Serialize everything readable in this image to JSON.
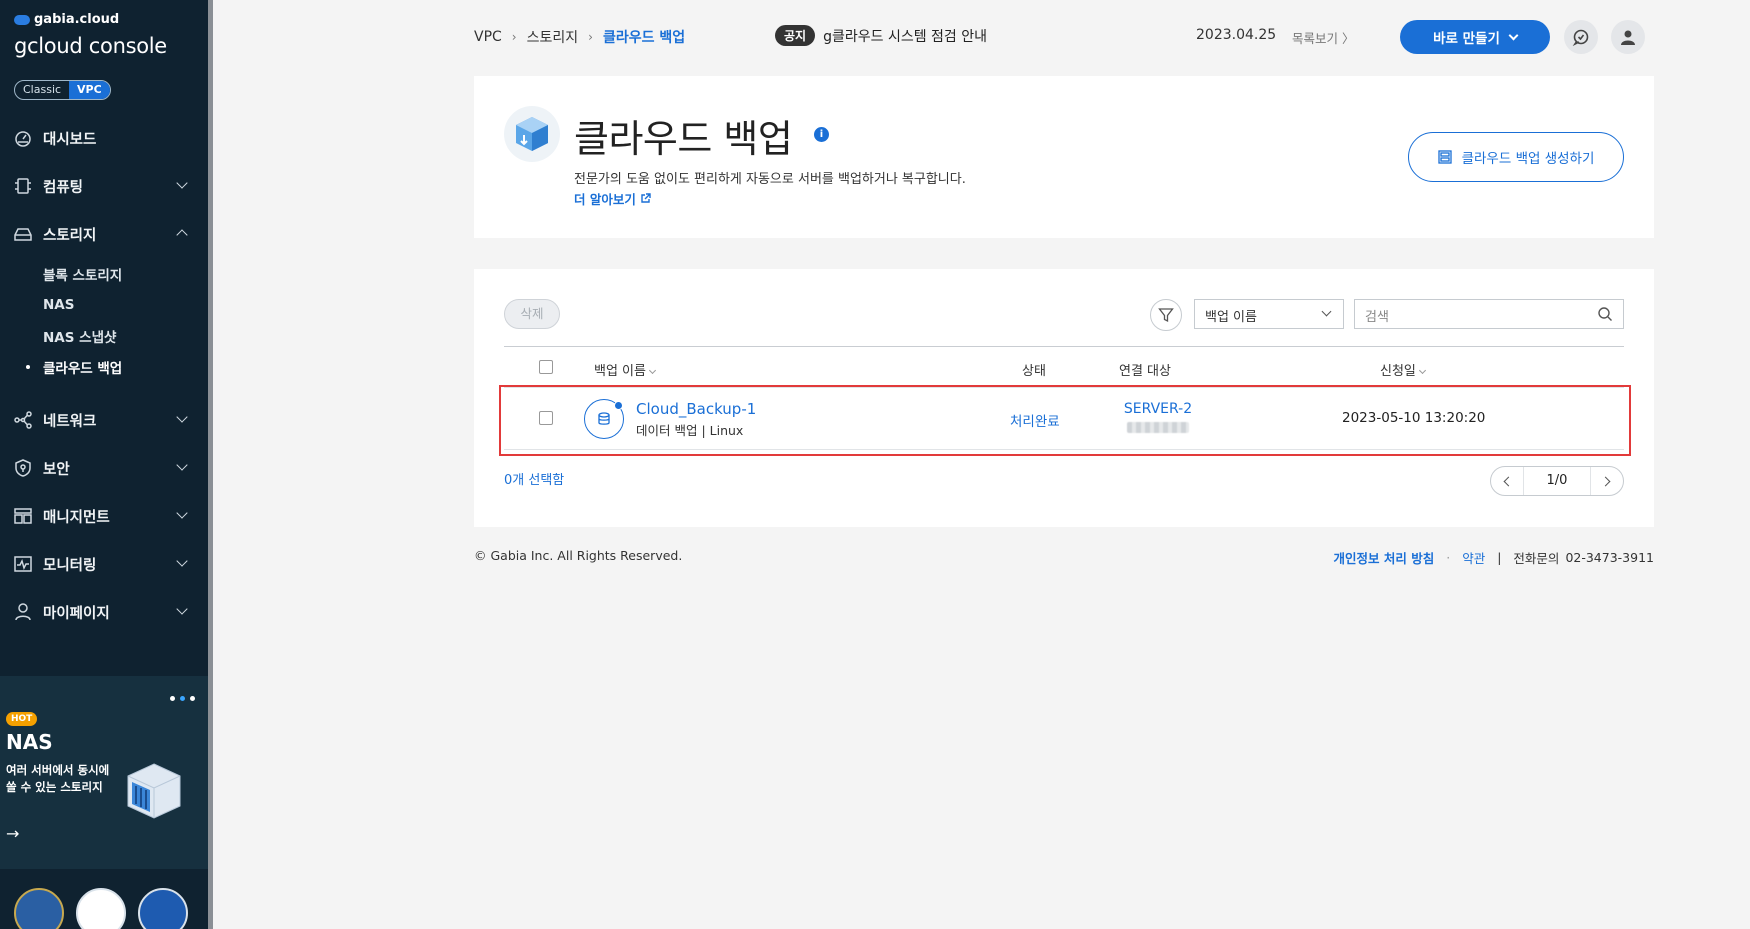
{
  "sidebar": {
    "brand_small": "gabia.cloud",
    "brand_main_bold": "gcloud",
    "brand_main_rest": " console",
    "modes": [
      "Classic",
      "VPC"
    ],
    "active_mode": "VPC",
    "nav": [
      {
        "label": "대시보드",
        "icon": "dashboard-icon"
      },
      {
        "label": "컴퓨팅",
        "icon": "cpu-icon",
        "expanded": false
      },
      {
        "label": "스토리지",
        "icon": "storage-icon",
        "expanded": true
      },
      {
        "label": "네트워크",
        "icon": "network-icon",
        "expanded": false
      },
      {
        "label": "보안",
        "icon": "shield-icon",
        "expanded": false
      },
      {
        "label": "매니지먼트",
        "icon": "management-icon",
        "expanded": false
      },
      {
        "label": "모니터링",
        "icon": "monitoring-icon",
        "expanded": false
      },
      {
        "label": "마이페이지",
        "icon": "user-icon",
        "expanded": false
      }
    ],
    "storage_sub": [
      "블록 스토리지",
      "NAS",
      "NAS 스냅샷",
      "클라우드 백업"
    ],
    "current_sub": "클라우드 백업",
    "promo": {
      "badge": "HOT",
      "title": "NAS",
      "desc_line1": "여러 서버에서 동시에",
      "desc_line2": "쓸 수 있는 스토리지",
      "arrow": "→"
    }
  },
  "topbar": {
    "breadcrumb": [
      "VPC",
      "스토리지",
      "클라우드 백업"
    ],
    "notice_tag": "공지",
    "notice_text": "g클라우드 시스템 점검 안내",
    "notice_date": "2023.04.25",
    "notice_more": "목록보기 〉",
    "create_label": "바로 만들기"
  },
  "header": {
    "title": "클라우드 백업",
    "info": "i",
    "description": "전문가의 도움 없이도 편리하게 자동으로 서버를 백업하거나 복구합니다.",
    "learn_more": "더 알아보기",
    "create_button": "클라우드 백업 생성하기"
  },
  "list": {
    "delete_label": "삭제",
    "filter_select": "백업 이름",
    "search_placeholder": "검색",
    "columns": {
      "name": "백업 이름",
      "status": "상태",
      "target": "연결 대상",
      "date": "신청일"
    },
    "rows": [
      {
        "name": "Cloud_Backup-1",
        "sub": "데이터 백업 | Linux",
        "status": "처리완료",
        "target": "SERVER-2",
        "date": "2023-05-10 13:20:20"
      }
    ],
    "selected_count": "0개 선택함",
    "page": "1/0"
  },
  "footer": {
    "copyright": "© Gabia Inc. All Rights Reserved.",
    "privacy": "개인정보 처리 방침",
    "dot": "·",
    "terms": "약관",
    "divider": "|",
    "phone_label": "전화문의",
    "phone": "02-3473-3911"
  },
  "colors": {
    "accent": "#1a6fd6",
    "sidebar_bg": "#0f2230",
    "highlight": "#e23a3a",
    "hot": "#f5a000"
  }
}
